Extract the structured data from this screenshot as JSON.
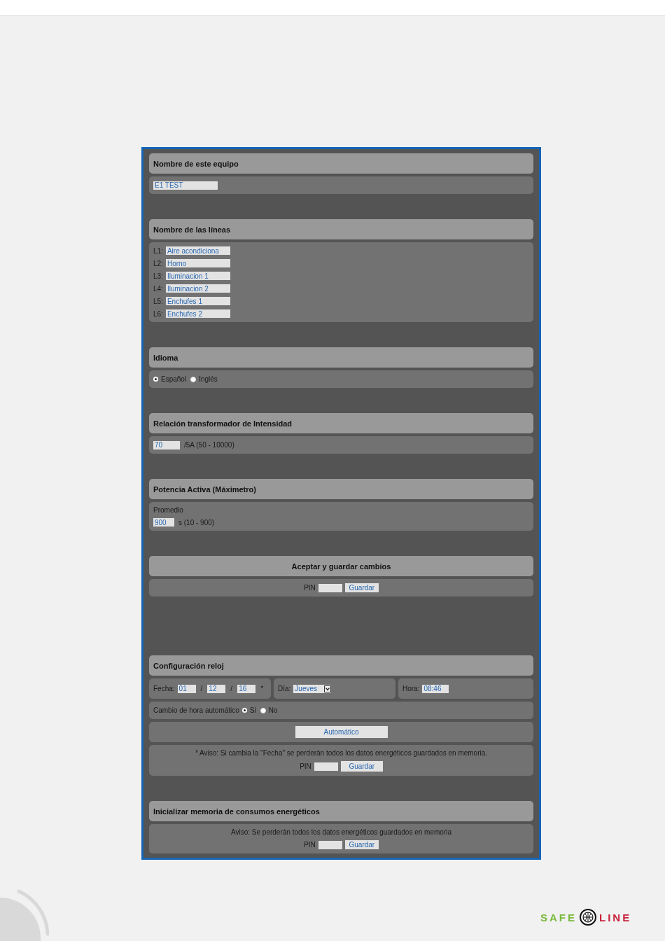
{
  "device_name": {
    "title": "Nombre de este equipo",
    "value": "E1 TEST"
  },
  "lines": {
    "title": "Nombre de las líneas",
    "items": [
      {
        "label": "L1:",
        "value": "Aire acondiciona"
      },
      {
        "label": "L2:",
        "value": "Horno"
      },
      {
        "label": "L3:",
        "value": "Iluminacion 1"
      },
      {
        "label": "L4:",
        "value": "Iluminacion 2"
      },
      {
        "label": "L5:",
        "value": "Enchufes 1"
      },
      {
        "label": "L6:",
        "value": "Enchufes 2"
      }
    ]
  },
  "language": {
    "title": "Idioma",
    "options": [
      {
        "label": "Español",
        "selected": true
      },
      {
        "label": "Inglés",
        "selected": false
      }
    ]
  },
  "ct_ratio": {
    "title": "Relación transformador de Intensidad",
    "value": "70",
    "suffix": "/5A (50 - 10000)"
  },
  "active_power": {
    "title": "Potencia Activa (Máximetro)",
    "label": "Promedio",
    "value": "900",
    "suffix": "s (10 - 900)"
  },
  "save": {
    "title": "Aceptar y guardar cambios",
    "pin_label": "PIN",
    "button": "Guardar"
  },
  "clock": {
    "title": "Configuración reloj",
    "date_label": "Fecha:",
    "date_items": [
      {
        "kind": "field",
        "text": "01"
      },
      {
        "kind": "text",
        "text": "/"
      },
      {
        "kind": "field",
        "text": "12"
      },
      {
        "kind": "text",
        "text": "/"
      },
      {
        "kind": "field",
        "text": "16"
      },
      {
        "kind": "text",
        "text": "*"
      }
    ],
    "day_label": "Día:",
    "day_value": "Jueves",
    "time_label": "Hora:",
    "time_value": "08:46",
    "dst": {
      "label": "Cambio de hora automático",
      "options": [
        {
          "label": "Si",
          "selected": true
        },
        {
          "label": "No",
          "selected": false
        }
      ]
    },
    "auto_button": "Automático",
    "warning": "* Aviso: Si cambia la \"Fecha\" se perderán todos los datos energéticos guardados en memoria.",
    "pin_label": "PIN",
    "button": "Guardar"
  },
  "reset": {
    "title": "Inicializar memoria de consumos energéticos",
    "warning": "Aviso: Se perderán todos los datos energéticos guardados en memoria",
    "pin_label": "PIN",
    "button": "Guardar"
  },
  "logo": {
    "left": "SAFE",
    "right": "LINE"
  }
}
